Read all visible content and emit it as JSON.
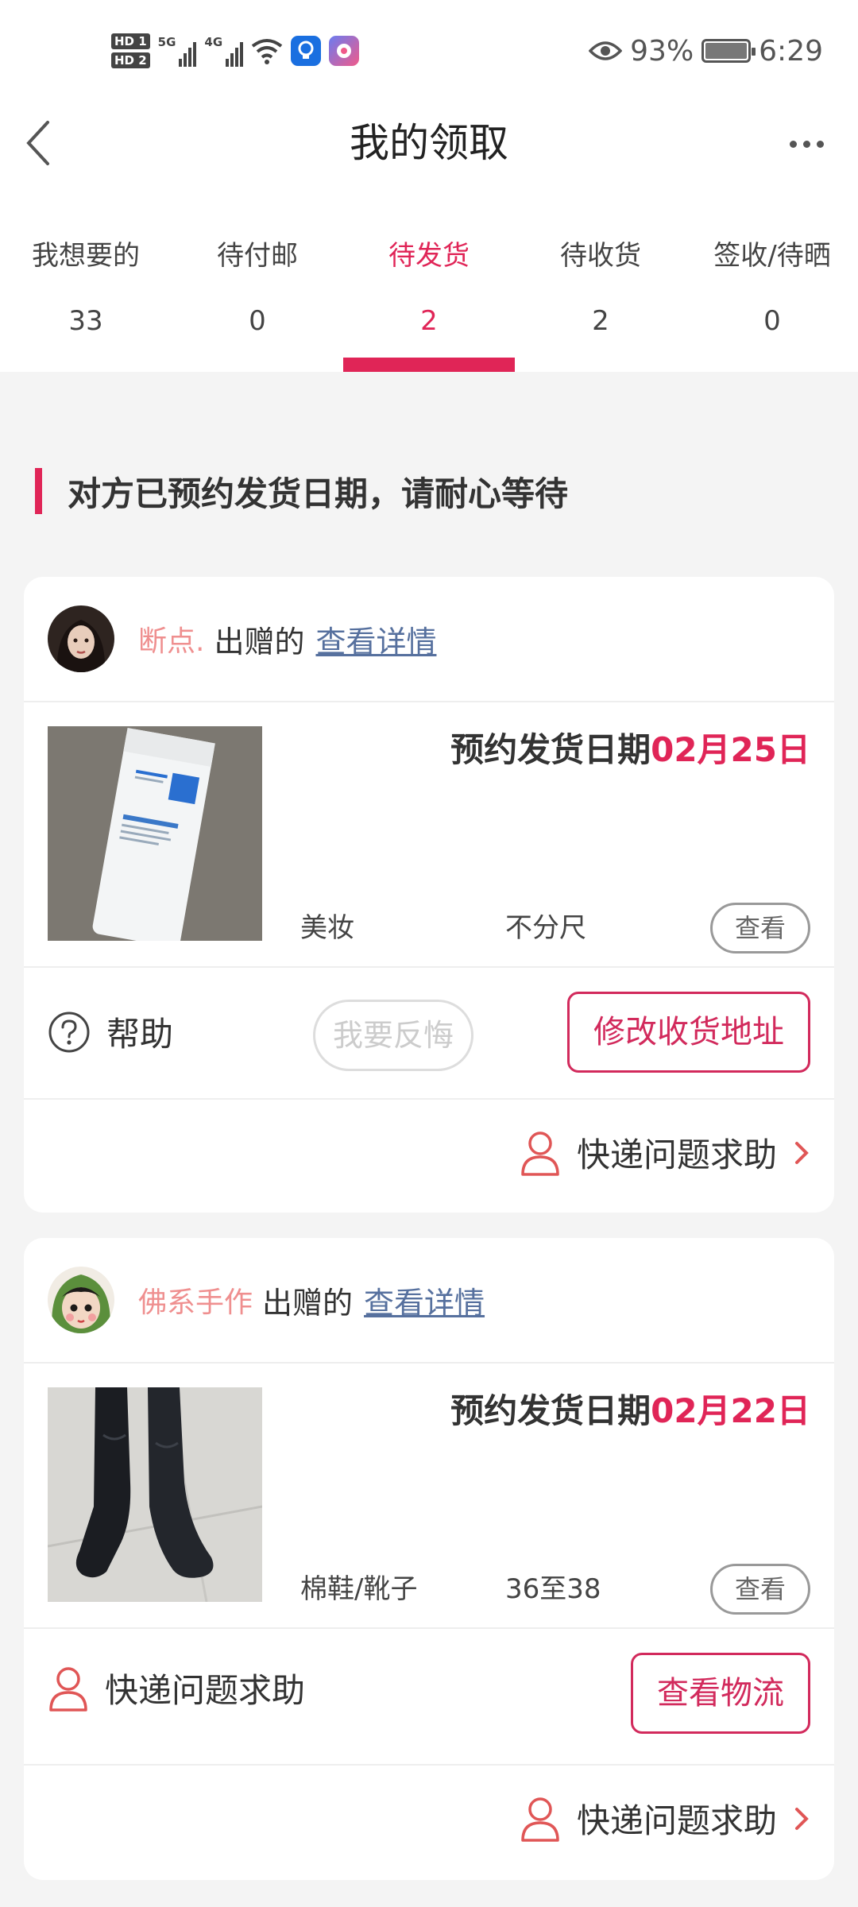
{
  "status_bar": {
    "hd1": "HD 1",
    "hd2": "HD 2",
    "net1": "5G",
    "net2": "4G",
    "battery": "93%",
    "time": "6:29",
    "icons": [
      "eye-icon",
      "wifi-icon",
      "battery-icon"
    ]
  },
  "header": {
    "title": "我的领取"
  },
  "tabs": [
    {
      "label": "我想要的",
      "count": "33"
    },
    {
      "label": "待付邮",
      "count": "0"
    },
    {
      "label": "待发货",
      "count": "2"
    },
    {
      "label": "待收货",
      "count": "2"
    },
    {
      "label": "签收/待晒",
      "count": "0"
    }
  ],
  "active_tab": 2,
  "accent_color": "#e02557",
  "notice": "对方已预约发货日期，请耐心等待",
  "cards": [
    {
      "seller": "断点.",
      "gave_text": "出赠的",
      "detail_link": "查看详情",
      "ship_label": "预约发货日期",
      "ship_date": "02月25日",
      "category": "美妆",
      "size": "不分尺",
      "view_label": "查看",
      "help_label": "帮助",
      "regret_label": "我要反悔",
      "primary_action": "修改收货地址",
      "express_help": "快递问题求助"
    },
    {
      "seller": "佛系手作",
      "gave_text": "出赠的",
      "detail_link": "查看详情",
      "ship_label": "预约发货日期",
      "ship_date": "02月22日",
      "category": "棉鞋/靴子",
      "size": "36至38",
      "view_label": "查看",
      "express_left": "快递问题求助",
      "primary_action": "查看物流",
      "express_help": "快递问题求助"
    }
  ]
}
